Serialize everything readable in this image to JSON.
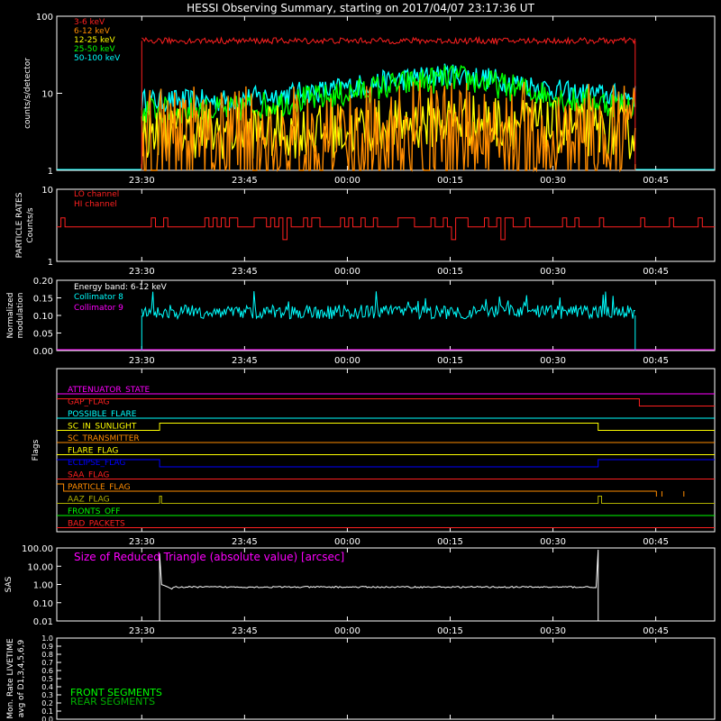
{
  "title": "HESSI Observing Summary, starting on 2017/04/07 23:17:36 UT",
  "time_ticks": [
    "23:30",
    "23:45",
    "00:00",
    "00:15",
    "00:30",
    "00:45"
  ],
  "colors": {
    "red": "#ff2020",
    "orange": "#ff8c00",
    "yellow": "#ffff00",
    "green": "#00ff00",
    "cyan": "#00ffff",
    "magenta": "#ff00ff",
    "blue": "#0000ff",
    "white": "#ffffff",
    "axis": "#ffffff",
    "dkyellow": "#b0b000",
    "dkgreen": "#00b000"
  },
  "chart_data": [
    {
      "type": "line",
      "name": "count-rates",
      "ylabel": "counts/s/detector",
      "ylog": true,
      "ylim": [
        1,
        100
      ],
      "ytick_labels": [
        "1",
        "10",
        "100"
      ],
      "data_range_minutes": [
        12.4,
        84.4
      ],
      "xlim_minutes": [
        0,
        96
      ],
      "series": [
        {
          "name": "3-6 keV",
          "color": "red",
          "baseline": 48,
          "noise": 0.04
        },
        {
          "name": "6-12 keV",
          "color": "orange",
          "baseline": 2.5,
          "noise": 0.7,
          "profile": [
            [
              12,
              2.4
            ],
            [
              40,
              2.6
            ],
            [
              50,
              3.0
            ],
            [
              62,
              3.0
            ],
            [
              75,
              2.7
            ],
            [
              85,
              2.6
            ]
          ]
        },
        {
          "name": "12-25 keV",
          "color": "yellow",
          "baseline": 3.0,
          "noise": 0.35,
          "profile": [
            [
              12,
              3.0
            ],
            [
              40,
              3.2
            ],
            [
              58,
              4.5
            ],
            [
              66,
              4.2
            ],
            [
              75,
              3.4
            ],
            [
              85,
              3.0
            ]
          ]
        },
        {
          "name": "25-50 keV",
          "color": "green",
          "baseline": 6.0,
          "noise": 0.18,
          "profile": [
            [
              12,
              6
            ],
            [
              25,
              6
            ],
            [
              40,
              9
            ],
            [
              50,
              13
            ],
            [
              58,
              16
            ],
            [
              66,
              12
            ],
            [
              75,
              8
            ],
            [
              85,
              7
            ]
          ]
        },
        {
          "name": "50-100 keV",
          "color": "cyan",
          "baseline": 8.0,
          "noise": 0.15,
          "profile": [
            [
              12,
              8
            ],
            [
              25,
              8
            ],
            [
              40,
              11
            ],
            [
              50,
              15
            ],
            [
              58,
              18
            ],
            [
              66,
              14
            ],
            [
              75,
              10
            ],
            [
              85,
              9
            ]
          ]
        }
      ]
    },
    {
      "type": "line",
      "name": "particle-rates",
      "ylabel": "PARTICLE RATES Counts/s",
      "ylog": true,
      "ylim": [
        1,
        10
      ],
      "ytick_labels": [
        "1",
        "10"
      ],
      "series": [
        {
          "name": "LO channel",
          "color": "red",
          "levels": [
            3,
            4,
            5,
            2
          ]
        },
        {
          "name": "HI channel",
          "color": "red",
          "levels": []
        }
      ]
    },
    {
      "type": "line",
      "name": "modulation",
      "ylabel": "Normalized modulation",
      "ylim": [
        0,
        0.2
      ],
      "ytick_labels": [
        "0.00",
        "0.05",
        "0.10",
        "0.15",
        "0.20"
      ],
      "legend_header": "Energy band: 6-12 keV",
      "series": [
        {
          "name": "Collimator 8",
          "color": "cyan",
          "baseline": 0.11,
          "noise": 0.02
        },
        {
          "name": "Collimator 9",
          "color": "magenta"
        }
      ]
    },
    {
      "type": "line",
      "name": "flags",
      "ylabel": "Flags",
      "flags": [
        {
          "name": "ATTENUATOR_STATE",
          "color": "magenta",
          "segments": [
            [
              0,
              0
            ],
            [
              96,
              0
            ]
          ]
        },
        {
          "name": "GAP_FLAG",
          "color": "red",
          "segments": [
            [
              0,
              1
            ],
            [
              85,
              1
            ],
            [
              85,
              0
            ],
            [
              96,
              0
            ]
          ]
        },
        {
          "name": "POSSIBLE_FLARE",
          "color": "cyan",
          "segments": [
            [
              0,
              0
            ],
            [
              96,
              0
            ]
          ]
        },
        {
          "name": "SC_IN_SUNLIGHT",
          "color": "yellow",
          "segments": [
            [
              0,
              0
            ],
            [
              15,
              0
            ],
            [
              15,
              1
            ],
            [
              79,
              1
            ],
            [
              79,
              0
            ],
            [
              96,
              0
            ]
          ]
        },
        {
          "name": "SC_TRANSMITTER",
          "color": "orange",
          "segments": [
            [
              0,
              0
            ],
            [
              96,
              0
            ]
          ]
        },
        {
          "name": "FLARE_FLAG",
          "color": "yellow",
          "segments": [
            [
              0,
              0
            ],
            [
              96,
              0
            ]
          ]
        },
        {
          "name": "ECLIPSE_FLAG",
          "color": "blue",
          "segments": [
            [
              0,
              1
            ],
            [
              15,
              1
            ],
            [
              15,
              0
            ],
            [
              79,
              0
            ],
            [
              79,
              1
            ],
            [
              96,
              1
            ]
          ]
        },
        {
          "name": "SAA_FLAG",
          "color": "red",
          "segments": [
            [
              0,
              0
            ],
            [
              96,
              0
            ]
          ]
        },
        {
          "name": "PARTICLE_FLAG",
          "color": "orange",
          "segments": [
            [
              0,
              1
            ],
            [
              1,
              1
            ],
            [
              1,
              0
            ],
            [
              87.5,
              0
            ]
          ]
        },
        {
          "name": "AAZ_FLAG",
          "color": "dkyellow",
          "segments": [
            [
              0,
              0
            ],
            [
              15,
              0
            ],
            [
              15,
              1
            ],
            [
              15.3,
              1
            ],
            [
              15.3,
              0
            ],
            [
              79,
              0
            ],
            [
              79,
              1
            ],
            [
              79.5,
              1
            ],
            [
              79.5,
              0
            ],
            [
              96,
              0
            ]
          ]
        },
        {
          "name": "FRONTS_OFF",
          "color": "green",
          "segments": [
            [
              0,
              0
            ],
            [
              96,
              0
            ]
          ]
        },
        {
          "name": "BAD_PACKETS",
          "color": "red",
          "segments": [
            [
              0,
              0
            ],
            [
              96,
              0
            ]
          ]
        }
      ]
    },
    {
      "type": "line",
      "name": "sas",
      "ylabel": "SAS",
      "ylog": true,
      "ylim": [
        0.01,
        100
      ],
      "ytick_labels": [
        "0.01",
        "0.10",
        "1.00",
        "10.00",
        "100.00"
      ],
      "series_label": "Size of Reduced Triangle (absolute value) [arcsec]",
      "series": [
        {
          "name": "Size of Reduced Triangle",
          "color": "white",
          "baseline": 0.72,
          "range_minutes": [
            15,
            79
          ]
        }
      ]
    },
    {
      "type": "line",
      "name": "livetime",
      "ylabel": "Mon. Rate LIVETIME avg of D1,3,4,5,6,9",
      "ylim": [
        0,
        1
      ],
      "ytick_labels": [
        "0.0",
        "0.1",
        "0.2",
        "0.3",
        "0.4",
        "0.5",
        "0.6",
        "0.7",
        "0.8",
        "0.9",
        "1.0"
      ],
      "legend": [
        {
          "name": "FRONT SEGMENTS",
          "color": "green"
        },
        {
          "name": "REAR SEGMENTS",
          "color": "dkgreen"
        }
      ]
    }
  ]
}
